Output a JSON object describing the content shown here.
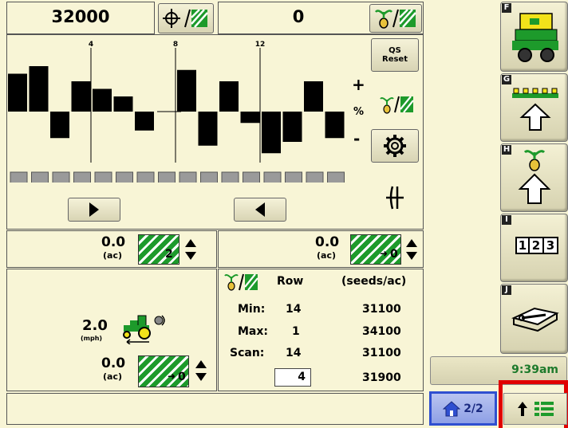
{
  "header": {
    "population_target": "32000",
    "offset_value": "0"
  },
  "rows": {
    "tick_labels": [
      "4",
      "8",
      "12"
    ],
    "bar_deviations": [
      0.5,
      0.6,
      -0.35,
      0.4,
      0.3,
      0.2,
      -0.25,
      0,
      0.55,
      -0.45,
      0.4,
      -0.15,
      -0.55,
      -0.4,
      0.4,
      -0.35
    ],
    "plus_sign": "+",
    "percent_sign": "%",
    "minus_sign": "-",
    "qs_reset_label": "QS\nReset",
    "row_count": 16
  },
  "area_left": {
    "value": "0.0",
    "unit": "(ac)",
    "index": "2"
  },
  "area_right": {
    "value": "0.0",
    "unit": "(ac)",
    "index": "0"
  },
  "speed": {
    "value": "2.0",
    "unit": "(mph)"
  },
  "area_bottom": {
    "value": "0.0",
    "unit": "(ac)",
    "index": "0"
  },
  "stats": {
    "col_row": "Row",
    "col_seeds": "(seeds/ac)",
    "rows": [
      {
        "label": "Min:",
        "row": "14",
        "seeds": "31100"
      },
      {
        "label": "Max:",
        "row": "1",
        "seeds": "34100"
      },
      {
        "label": "Scan:",
        "row": "14",
        "seeds": "31100"
      }
    ],
    "input_row": "4",
    "input_seeds": "31900"
  },
  "sidebar": {
    "items": [
      {
        "letter": "F",
        "name": "planter"
      },
      {
        "letter": "G",
        "name": "row-unit-up"
      },
      {
        "letter": "H",
        "name": "seed-up"
      },
      {
        "letter": "I",
        "name": "numbers",
        "digits": [
          "1",
          "2",
          "3"
        ]
      },
      {
        "letter": "J",
        "name": "manual-book"
      }
    ],
    "clock": "9:39am"
  },
  "footer": {
    "page": "2/2"
  },
  "colors": {
    "green": "#1d9a2b",
    "yellow": "#f2e21a",
    "background": "#f8f5d6",
    "highlight_red": "#e00000",
    "home_blue": "#2f4fd0"
  }
}
